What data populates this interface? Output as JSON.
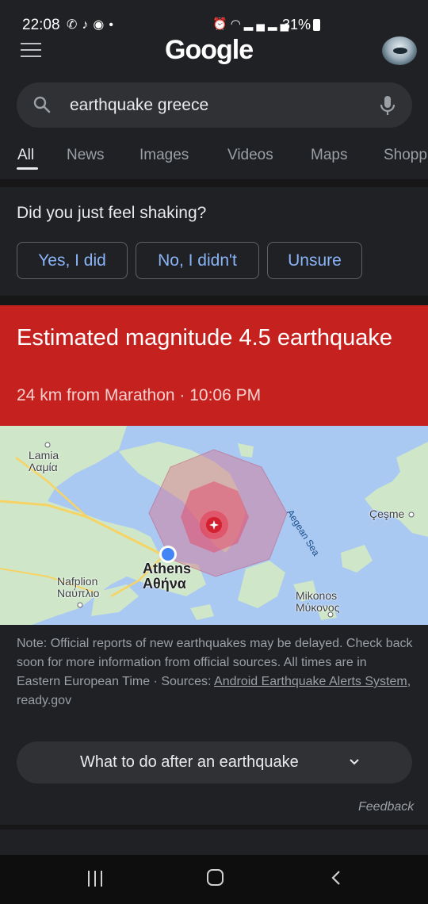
{
  "status_bar": {
    "time": "22:08",
    "notification_icons": [
      "whatsapp-icon",
      "tiktok-icon",
      "messenger-icon",
      "dot-icon"
    ],
    "system_icons": [
      "alarm-icon",
      "wifi-icon",
      "signal-icon",
      "signal-icon"
    ],
    "battery": "31%"
  },
  "header": {
    "logo": "Google",
    "menu_icon": "menu-icon",
    "avatar": "profile-avatar"
  },
  "search": {
    "query": "earthquake greece",
    "icon": "search-icon",
    "mic_icon": "mic-icon"
  },
  "tabs": [
    {
      "label": "All",
      "active": true
    },
    {
      "label": "News",
      "active": false
    },
    {
      "label": "Images",
      "active": false
    },
    {
      "label": "Videos",
      "active": false
    },
    {
      "label": "Maps",
      "active": false
    },
    {
      "label": "Shopp",
      "active": false
    }
  ],
  "shake_card": {
    "question": "Did you just feel shaking?",
    "options": [
      "Yes, I did",
      "No, I didn't",
      "Unsure"
    ]
  },
  "alert": {
    "title": "Estimated magnitude 4.5 earthquake",
    "subtitle": "24 km from Marathon · 10:06 PM",
    "color": "#c5221f"
  },
  "map": {
    "labels": {
      "lamia": "Lamia",
      "lamia_greek": "Λαμία",
      "athens": "Athens",
      "athens_greek": "Αθήνα",
      "nafplion": "Nafplion",
      "nafplion_greek": "Ναύπλιο",
      "mikonos": "Mikonos",
      "mikonos_greek": "Μύκονος",
      "cesme": "Çeşme",
      "sea": "Aegean Sea"
    }
  },
  "note": {
    "line1": "Note: Official reports of new earthquakes may be delayed. Check back soon for more information from official sources. All times are in Eastern European Time · Sources: ",
    "link": "Android Earthquake Alerts System",
    "after_link": ", ready.gov"
  },
  "expand": {
    "label": "What to do after an earthquake",
    "icon": "chevron-down-icon"
  },
  "feedback": "Feedback",
  "navbar": {
    "icons": [
      "recents-icon",
      "home-icon",
      "back-icon"
    ]
  }
}
